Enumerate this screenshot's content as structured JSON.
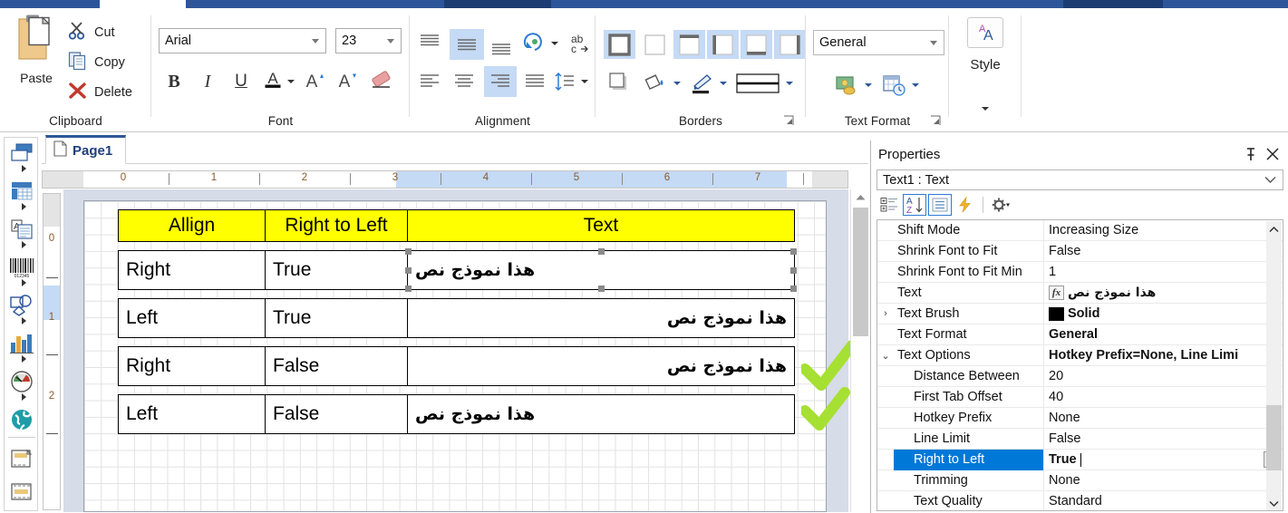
{
  "ribbon": {
    "groups": [
      {
        "label": "Clipboard"
      },
      {
        "label": "Font"
      },
      {
        "label": "Alignment"
      },
      {
        "label": "Borders"
      },
      {
        "label": "Text Format"
      },
      {
        "label": "Style"
      }
    ],
    "clipboard": {
      "paste_label": "Paste",
      "cut_label": "Cut",
      "copy_label": "Copy",
      "delete_label": "Delete"
    },
    "font": {
      "family_value": "Arial",
      "size_value": "23",
      "bold_label": "B",
      "italic_label": "I",
      "underline_label": "U",
      "font_color_label": "A",
      "grow_font_label": "A",
      "shrink_font_label": "A",
      "clear_format_name": "eraser-icon"
    },
    "text_format": {
      "format_value": "General"
    },
    "style": {
      "label": "Style"
    }
  },
  "document": {
    "page_tab_label": "Page1",
    "hruler_ticks": [
      "0",
      "1",
      "2",
      "3",
      "4",
      "5",
      "6",
      "7"
    ],
    "vruler_ticks": [
      "0",
      "1",
      "2"
    ],
    "table": {
      "headers": [
        "Allign",
        "Right to Left",
        "Text"
      ],
      "rows": [
        {
          "align": "Right",
          "rtl": "True",
          "text": "هذا نموذج نص",
          "text_align": "left",
          "selected": true
        },
        {
          "align": "Left",
          "rtl": "True",
          "text": "هذا نموذج نص",
          "text_align": "right",
          "selected": false
        },
        {
          "align": "Right",
          "rtl": "False",
          "text": "هذا نموذج نص",
          "text_align": "right",
          "selected": false
        },
        {
          "align": "Left",
          "rtl": "False",
          "text": "هذا نموذج نص",
          "text_align": "left",
          "selected": false
        }
      ]
    },
    "annotations": {
      "checkmark_color": "#a6e033",
      "count": 2
    },
    "header_fill": "#ffff00"
  },
  "properties": {
    "title": "Properties",
    "object_selector": "Text1 : Text",
    "rows": [
      {
        "name": "Shift Mode",
        "value": "Increasing Size",
        "indent": false,
        "expander": "",
        "bold": false,
        "selected": false
      },
      {
        "name": "Shrink Font to Fit",
        "value": "False",
        "indent": false,
        "expander": "",
        "bold": false,
        "selected": false
      },
      {
        "name": "Shrink Font to Fit Min",
        "value": "1",
        "indent": false,
        "expander": "",
        "bold": false,
        "selected": false
      },
      {
        "name": "Text",
        "value": "هذا نموذج نص",
        "indent": false,
        "expander": "",
        "bold": true,
        "selected": false,
        "fx": true,
        "rtl": true
      },
      {
        "name": "Text Brush",
        "value": "Solid",
        "indent": false,
        "expander": ">",
        "bold": true,
        "selected": false,
        "swatch": true
      },
      {
        "name": "Text Format",
        "value": "General",
        "indent": false,
        "expander": "",
        "bold": true,
        "selected": false
      },
      {
        "name": "Text Options",
        "value": "Hotkey Prefix=None, Line Limi",
        "indent": false,
        "expander": "v",
        "bold": true,
        "selected": false
      },
      {
        "name": "Distance Between",
        "value": "20",
        "indent": true,
        "expander": "",
        "bold": false,
        "selected": false
      },
      {
        "name": "First Tab Offset",
        "value": "40",
        "indent": true,
        "expander": "",
        "bold": false,
        "selected": false
      },
      {
        "name": "Hotkey Prefix",
        "value": "None",
        "indent": true,
        "expander": "",
        "bold": false,
        "selected": false
      },
      {
        "name": "Line Limit",
        "value": "False",
        "indent": true,
        "expander": "",
        "bold": false,
        "selected": false
      },
      {
        "name": "Right to Left",
        "value": "True",
        "indent": true,
        "expander": "",
        "bold": true,
        "selected": true,
        "editing": true
      },
      {
        "name": "Trimming",
        "value": "None",
        "indent": true,
        "expander": "",
        "bold": false,
        "selected": false
      },
      {
        "name": "Text Quality",
        "value": "Standard",
        "indent": true,
        "expander": "",
        "bold": false,
        "selected": false
      }
    ]
  },
  "colors": {
    "accent": "#2c5699",
    "selection_blue": "#0078d7",
    "ribbon_highlight": "#c5daf5",
    "header_yellow": "#ffff00",
    "check_green": "#a6e033"
  }
}
